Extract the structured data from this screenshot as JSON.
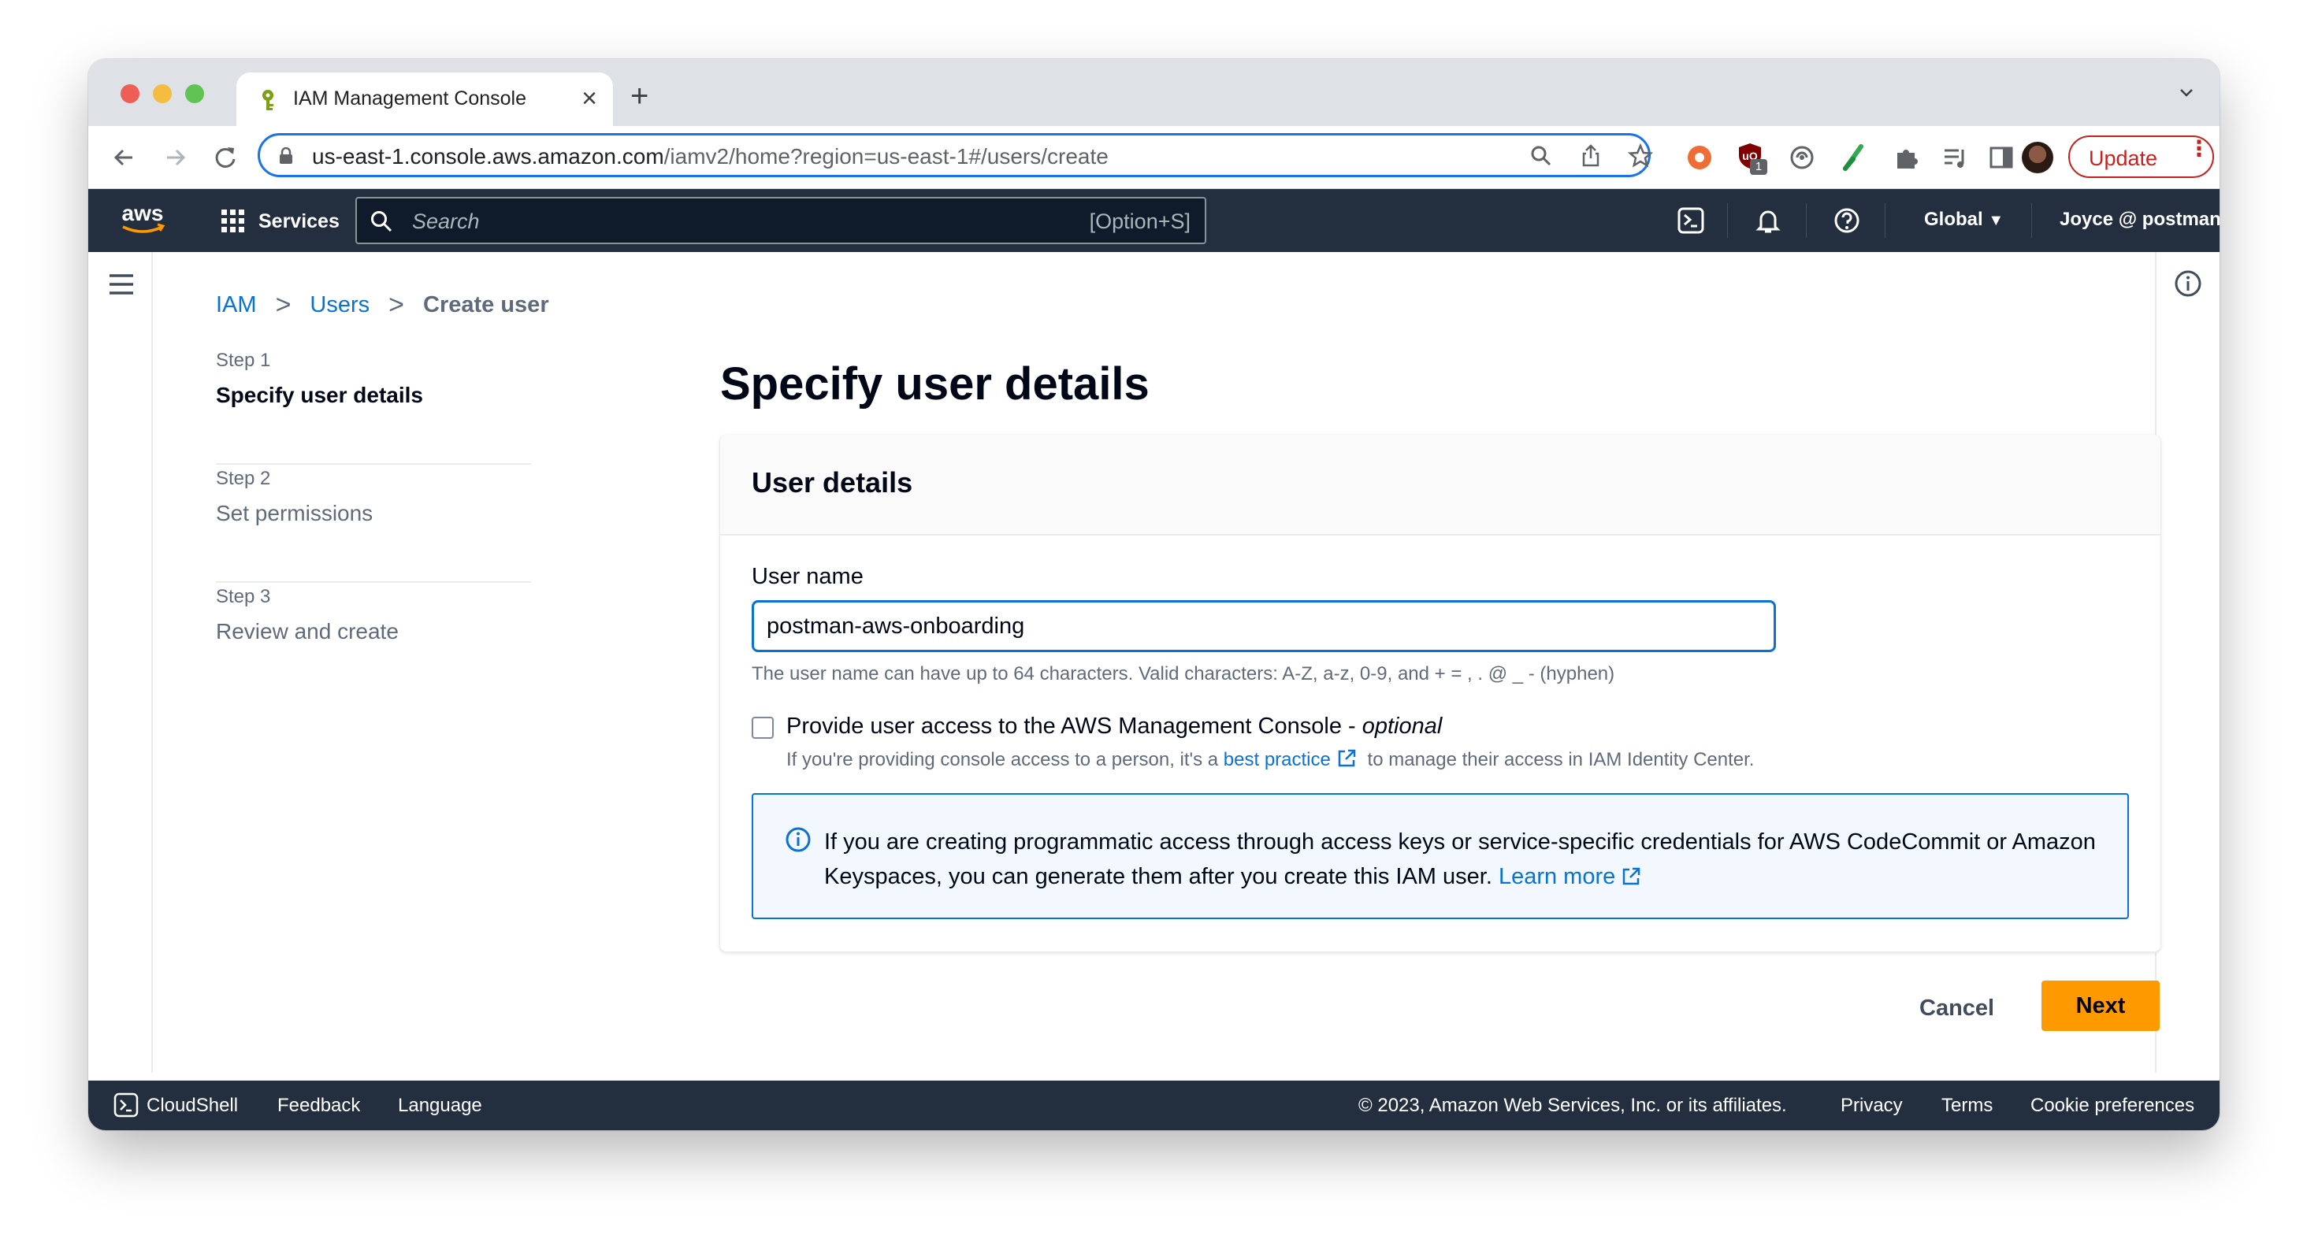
{
  "browser": {
    "tab_title": "IAM Management Console",
    "url_host": "us-east-1.console.aws.amazon.com",
    "url_path": "/iamv2/home?region=us-east-1#/users/create",
    "extension_badge": "1",
    "update_label": "Update"
  },
  "aws_nav": {
    "logo_text": "aws",
    "services_label": "Services",
    "search_placeholder": "Search",
    "search_shortcut": "[Option+S]",
    "region_label": "Global",
    "account_label": "Joyce @ postman-labs"
  },
  "breadcrumb": {
    "items": [
      "IAM",
      "Users"
    ],
    "current": "Create user"
  },
  "steps": [
    {
      "num": "Step 1",
      "name": "Specify user details"
    },
    {
      "num": "Step 2",
      "name": "Set permissions"
    },
    {
      "num": "Step 3",
      "name": "Review and create"
    }
  ],
  "page_title": "Specify user details",
  "panel": {
    "header": "User details",
    "username_label": "User name",
    "username_value": "postman-aws-onboarding",
    "username_help": "The user name can have up to 64 characters. Valid characters: A-Z, a-z, 0-9, and + = , . @ _ - (hyphen)",
    "console_access_label": "Provide user access to the AWS Management Console - ",
    "console_access_optional": "optional",
    "console_access_desc_pre": "If you're providing console access to a person, it's a ",
    "console_access_link": "best practice",
    "console_access_desc_post": " to manage their access in IAM Identity Center.",
    "alert_text": "If you are creating programmatic access through access keys or service-specific credentials for AWS CodeCommit or Amazon Keyspaces, you can generate them after you create this IAM user. ",
    "alert_link": "Learn more"
  },
  "actions": {
    "cancel_label": "Cancel",
    "next_label": "Next"
  },
  "footer": {
    "cloudshell": "CloudShell",
    "feedback": "Feedback",
    "language": "Language",
    "copyright": "© 2023, Amazon Web Services, Inc. or its affiliates.",
    "privacy": "Privacy",
    "terms": "Terms",
    "cookie": "Cookie preferences"
  },
  "colors": {
    "aws_nav_bg": "#232f3e",
    "link_blue": "#0972d3",
    "primary_orange": "#ff9900",
    "update_red": "#c5221f"
  }
}
